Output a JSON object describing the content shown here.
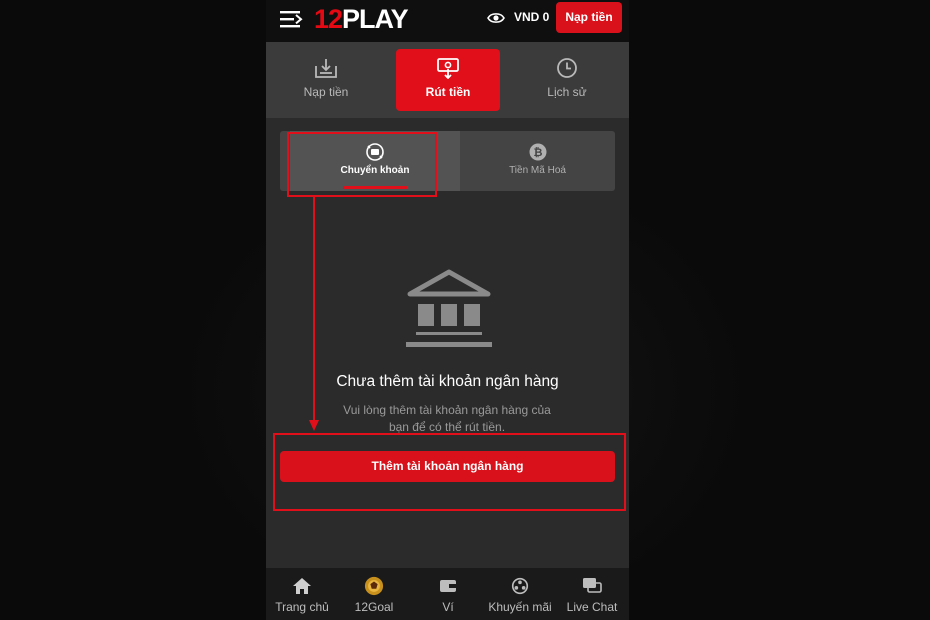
{
  "header": {
    "logo_number": "12",
    "logo_word": "PLAY",
    "balance": "VND 0",
    "deposit_button": "Nạp tiền"
  },
  "tabs": [
    {
      "label": "Nạp tiền",
      "icon": "deposit-icon",
      "active": false
    },
    {
      "label": "Rút tiền",
      "icon": "withdraw-icon",
      "active": true
    },
    {
      "label": "Lịch sử",
      "icon": "clock-icon",
      "active": false
    }
  ],
  "subtabs": [
    {
      "label": "Chuyển khoản",
      "icon": "bank-transfer-icon",
      "active": true
    },
    {
      "label": "Tiền Mã Hoá",
      "icon": "bitcoin-icon",
      "active": false
    }
  ],
  "empty_state": {
    "icon": "bank-icon",
    "title": "Chưa thêm tài khoản ngân hàng",
    "description": "Vui lòng thêm tài khoản ngân hàng của bạn để có thể rút tiền."
  },
  "add_bank_button": "Thêm tài khoản ngân hàng",
  "bottom_nav": [
    {
      "label": "Trang chủ",
      "icon": "home-icon"
    },
    {
      "label": "12Goal",
      "icon": "ball-icon"
    },
    {
      "label": "Ví",
      "icon": "wallet-icon"
    },
    {
      "label": "Khuyến mãi",
      "icon": "promo-icon"
    },
    {
      "label": "Live Chat",
      "icon": "chat-icon"
    }
  ],
  "colors": {
    "accent": "#e10f19",
    "header_bg": "#0f0f0f",
    "page_bg": "#2b2b2b",
    "annotation": "#e10f19"
  }
}
